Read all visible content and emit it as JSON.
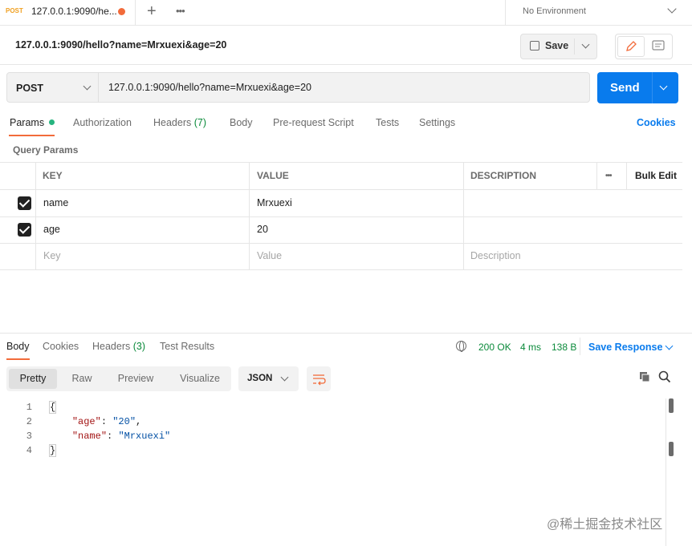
{
  "tabbar": {
    "active_tab": {
      "method": "POST",
      "title": "127.0.0.1:9090/he..."
    },
    "environment": "No Environment"
  },
  "request": {
    "title": "127.0.0.1:9090/hello?name=Mrxuexi&age=20",
    "save_label": "Save",
    "method": "POST",
    "url": "127.0.0.1:9090/hello?name=Mrxuexi&age=20",
    "send_label": "Send"
  },
  "request_tabs": {
    "params": "Params",
    "authorization": "Authorization",
    "headers": "Headers",
    "headers_count": "(7)",
    "body": "Body",
    "prerequest": "Pre-request Script",
    "tests": "Tests",
    "settings": "Settings",
    "cookies": "Cookies"
  },
  "query_params": {
    "label": "Query Params",
    "columns": {
      "key": "KEY",
      "value": "VALUE",
      "description": "DESCRIPTION",
      "more": "•••",
      "bulk_edit": "Bulk Edit"
    },
    "rows": [
      {
        "key": "name",
        "value": "Mrxuexi",
        "description": ""
      },
      {
        "key": "age",
        "value": "20",
        "description": ""
      }
    ],
    "placeholders": {
      "key": "Key",
      "value": "Value",
      "description": "Description"
    }
  },
  "response_tabs": {
    "body": "Body",
    "cookies": "Cookies",
    "headers": "Headers",
    "headers_count": "(3)",
    "test_results": "Test Results"
  },
  "response_meta": {
    "status": "200 OK",
    "time": "4 ms",
    "size": "138 B",
    "save_response": "Save Response"
  },
  "view_modes": {
    "pretty": "Pretty",
    "raw": "Raw",
    "preview": "Preview",
    "visualize": "Visualize"
  },
  "format": "JSON",
  "code": {
    "line_numbers": [
      "1",
      "2",
      "3",
      "4"
    ],
    "open_brace": "{",
    "close_brace": "}",
    "age_key": "\"age\"",
    "age_value": "\"20\"",
    "name_key": "\"name\"",
    "name_value": "\"Mrxuexi\""
  },
  "watermark": "@稀土掘金技术社区"
}
